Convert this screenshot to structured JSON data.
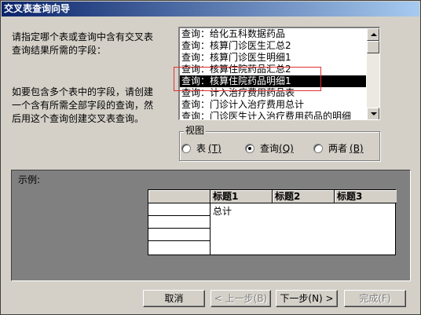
{
  "window": {
    "title": "交叉表查询向导"
  },
  "instructions": {
    "line1": "请指定哪个表或查询中含有交叉表",
    "line2": "查询结果所需的字段：",
    "hint1": "如要包含多个表中的字段，请创建",
    "hint2": "一个含有所需全部字段的查询，然",
    "hint3": "后用这个查询创建交叉表查询。"
  },
  "source_list": {
    "items": [
      "查询：给化五科数据药品",
      "查询：核算门诊医生汇总2",
      "查询：核算门诊医生明细1",
      "查询：核算住院药品汇总2",
      "查询：核算住院药品明细1",
      "查询：计入治疗费用药品表",
      "查询：门诊计入治疗费用总计",
      "查询：门诊医生计入治疗费用药品的明细"
    ],
    "selected_index": 4
  },
  "view_group": {
    "label": "视图",
    "options": [
      {
        "label": "表",
        "hotkey": "(T)",
        "checked": false
      },
      {
        "label": "查询",
        "hotkey": "(Q)",
        "checked": true
      },
      {
        "label": "两者",
        "hotkey": "(B)",
        "checked": false
      }
    ]
  },
  "example": {
    "label": "示例:",
    "headers": [
      "标题1",
      "标题2",
      "标题3"
    ],
    "total_label": "总计"
  },
  "buttons": {
    "cancel": "取消",
    "back": "< 上一步(B)",
    "next": "下一步(N) >",
    "finish": "完成(F)"
  },
  "colors": {
    "title_gradient_start": "#0a246a",
    "title_gradient_end": "#a6caf0",
    "face": "#d4d0c8",
    "selection": "#000000",
    "annotation_box": "#e03030",
    "preview_panel": "#808080"
  }
}
